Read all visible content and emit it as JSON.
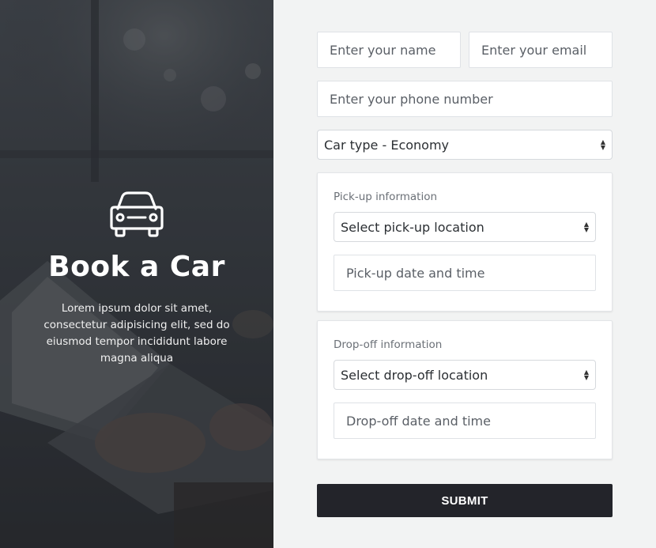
{
  "hero": {
    "title": "Book a Car",
    "description": "Lorem ipsum dolor sit amet, consectetur adipisicing elit, sed do eiusmod tempor incididunt labore magna aliqua",
    "icon": "car-icon"
  },
  "form": {
    "name_placeholder": "Enter your name",
    "email_placeholder": "Enter your email",
    "phone_placeholder": "Enter your phone number",
    "car_type": "Car type - Economy",
    "pickup": {
      "label": "Pick-up information",
      "location": "Select pick-up location",
      "datetime_placeholder": "Pick-up date and time"
    },
    "dropoff": {
      "label": "Drop-off information",
      "location": "Select drop-off location",
      "datetime_placeholder": "Drop-off date and time"
    },
    "submit_label": "SUBMIT"
  },
  "colors": {
    "submit_bg": "#23242a",
    "page_bg": "#f2f3f3",
    "field_border": "#dfe2e6"
  }
}
